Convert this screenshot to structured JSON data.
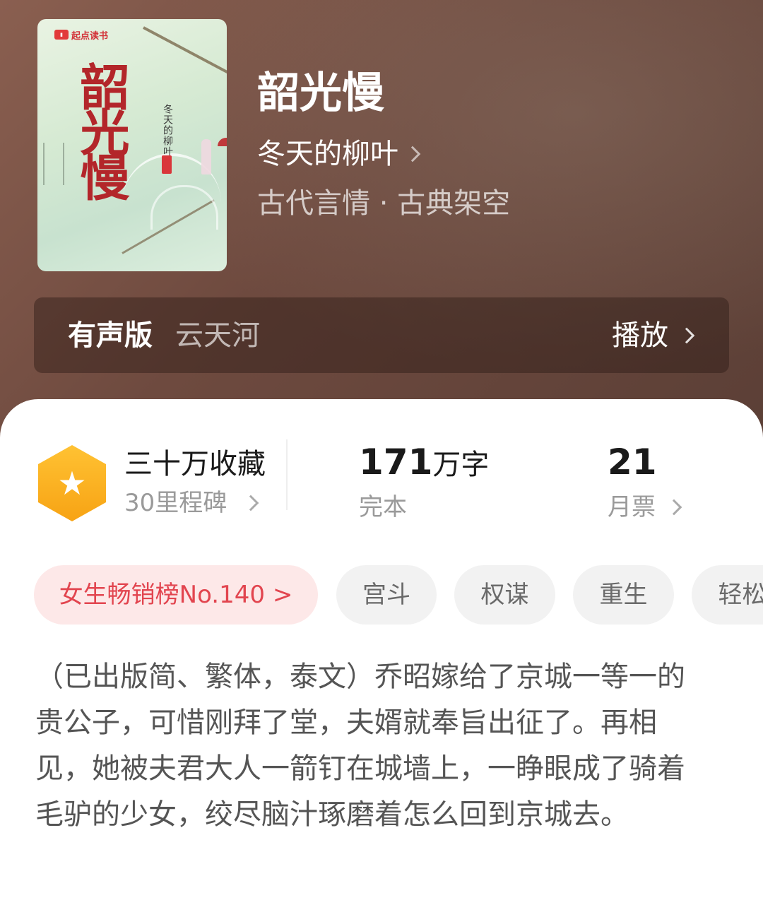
{
  "cover": {
    "publisher": "起点读书",
    "title": "韶光慢",
    "author": "冬天的柳叶"
  },
  "book": {
    "title": "韶光慢",
    "author": "冬天的柳叶",
    "genre": "古代言情 · 古典架空"
  },
  "audio": {
    "label": "有声版",
    "narrator": "云天河",
    "play_label": "播放"
  },
  "stats": {
    "favorites_title": "三十万收藏",
    "milestone": "30里程碑",
    "word_count": "171",
    "word_unit": "万字",
    "status": "完本",
    "monthly_votes": "21",
    "monthly_votes_label": "月票"
  },
  "tags": [
    "女生畅销榜No.140 >",
    "宫斗",
    "权谋",
    "重生",
    "轻松"
  ],
  "description": "（已出版简、繁体，泰文）乔昭嫁给了京城一等一的贵公子，可惜刚拜了堂，夫婿就奉旨出征了。再相见，她被夫君大人一箭钉在城墙上，一睁眼成了骑着毛驴的少女，绞尽脑汁琢磨着怎么回到京城去。",
  "colors": {
    "header_bg": "#6e4a3f",
    "accent_red": "#e2454f",
    "badge_orange": "#f7a314"
  }
}
